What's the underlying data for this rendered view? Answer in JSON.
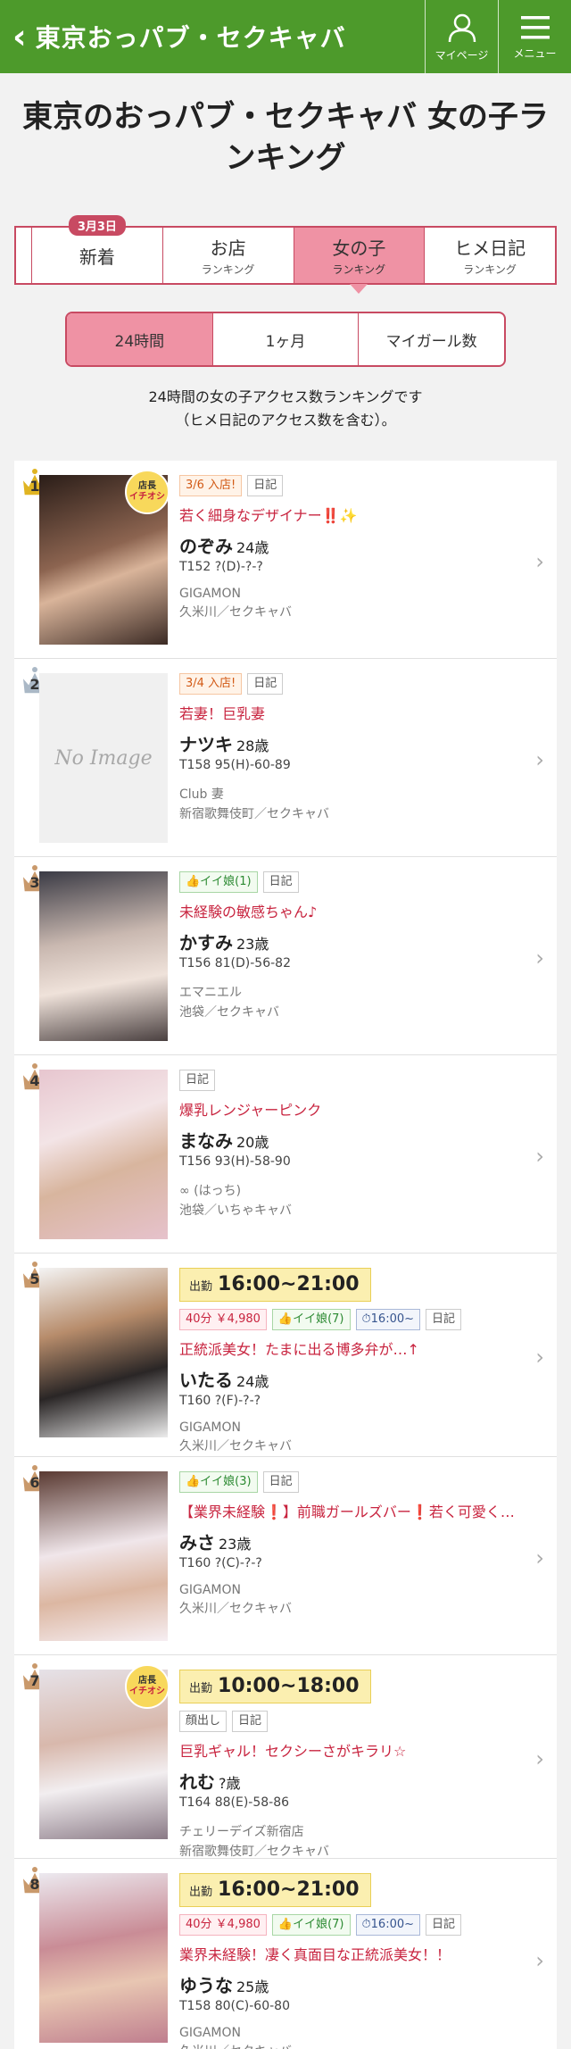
{
  "header": {
    "back_icon": "chevron-left-icon",
    "title": "東京おっパブ・セクキャバ",
    "mypage_label": "マイページ",
    "menu_label": "メニュー",
    "color": "#4d9a2b"
  },
  "page_title": "東京のおっパブ・セクキャバ 女の子ランキング",
  "category_tabs": {
    "new_badge": "3月3日",
    "items": [
      {
        "main": "",
        "sub": ""
      },
      {
        "main": "新着",
        "sub": ""
      },
      {
        "main": "お店",
        "sub": "ランキング"
      },
      {
        "main": "女の子",
        "sub": "ランキング"
      },
      {
        "main": "ヒメ日記",
        "sub": "ランキング"
      }
    ],
    "active_color": "#ef92a4"
  },
  "period_tabs": [
    "24時間",
    "1ヶ月",
    "マイガール数"
  ],
  "description": {
    "line1": "24時間の女の子アクセス数ランキングです",
    "line2": "（ヒメ日記のアクセス数を含む）。"
  },
  "ranking": [
    {
      "rank": "1",
      "crown": "gold",
      "ribbon": true,
      "no_image": false,
      "tags": [
        {
          "t": "3/6 入店!",
          "k": "new"
        },
        {
          "t": "日記",
          "k": ""
        }
      ],
      "work": null,
      "catch": "若く細身なデザイナー‼️✨",
      "name": "のぞみ",
      "age": "24歳",
      "spec": "T152 ?(D)-?-?",
      "shop": "GIGAMON",
      "area": "久米川／セクキャバ"
    },
    {
      "rank": "2",
      "crown": "silver",
      "ribbon": false,
      "no_image": true,
      "no_image_text": "No Image",
      "tags": [
        {
          "t": "3/4 入店!",
          "k": "new"
        },
        {
          "t": "日記",
          "k": ""
        }
      ],
      "work": null,
      "catch": "若妻！巨乳妻",
      "name": "ナツキ",
      "age": "28歳",
      "spec": "T158 95(H)-60-89",
      "shop": "Club 妻",
      "area": "新宿歌舞伎町／セクキャバ"
    },
    {
      "rank": "3",
      "crown": "bronze",
      "ribbon": false,
      "no_image": false,
      "tags": [
        {
          "t": "👍イイ娘(1)",
          "k": "iiko"
        },
        {
          "t": "日記",
          "k": ""
        }
      ],
      "work": null,
      "catch": "未経験の敏感ちゃん♪",
      "name": "かすみ",
      "age": "23歳",
      "spec": "T156 81(D)-56-82",
      "shop": "エマニエル",
      "area": "池袋／セクキャバ"
    },
    {
      "rank": "4",
      "crown": "bronze",
      "ribbon": false,
      "no_image": false,
      "tags": [
        {
          "t": "日記",
          "k": ""
        }
      ],
      "work": null,
      "catch": "爆乳レンジャーピンク",
      "name": "まなみ",
      "age": "20歳",
      "spec": "T156 93(H)-58-90",
      "shop": "∞ (はっち)",
      "area": "池袋／いちゃキャバ"
    },
    {
      "rank": "5",
      "crown": "bronze",
      "ribbon": false,
      "no_image": false,
      "work": {
        "label": "出勤",
        "time": "16:00~21:00"
      },
      "tags": [
        {
          "t": "40分 ￥4,980",
          "k": "price"
        },
        {
          "t": "👍イイ娘(7)",
          "k": "iiko"
        },
        {
          "t": "⏱16:00~",
          "k": "time"
        },
        {
          "t": "日記",
          "k": ""
        }
      ],
      "catch": "正統派美女！たまに出る博多弁が…↑",
      "name": "いたる",
      "age": "24歳",
      "spec": "T160 ?(F)-?-?",
      "shop": "GIGAMON",
      "area": "久米川／セクキャバ"
    },
    {
      "rank": "6",
      "crown": "bronze",
      "ribbon": false,
      "no_image": false,
      "tags": [
        {
          "t": "👍イイ娘(3)",
          "k": "iiko"
        },
        {
          "t": "日記",
          "k": ""
        }
      ],
      "work": null,
      "catch": "【業界未経験❗️】前職ガールズバー❗️若く可愛く…",
      "name": "みさ",
      "age": "23歳",
      "spec": "T160 ?(C)-?-?",
      "shop": "GIGAMON",
      "area": "久米川／セクキャバ"
    },
    {
      "rank": "7",
      "crown": "bronze",
      "ribbon": true,
      "no_image": false,
      "work": {
        "label": "出勤",
        "time": "10:00~18:00"
      },
      "tags": [
        {
          "t": "顔出し",
          "k": ""
        },
        {
          "t": "日記",
          "k": ""
        }
      ],
      "catch": "巨乳ギャル！セクシーさがキラリ☆",
      "name": "れむ",
      "age": "?歳",
      "spec": "T164 88(E)-58-86",
      "shop": "チェリーデイズ新宿店",
      "area": "新宿歌舞伎町／セクキャバ"
    },
    {
      "rank": "8",
      "crown": "bronze",
      "ribbon": false,
      "no_image": false,
      "work": {
        "label": "出勤",
        "time": "16:00~21:00"
      },
      "tags": [
        {
          "t": "40分 ￥4,980",
          "k": "price"
        },
        {
          "t": "👍イイ娘(7)",
          "k": "iiko"
        },
        {
          "t": "⏱16:00~",
          "k": "time"
        },
        {
          "t": "日記",
          "k": ""
        }
      ],
      "catch": "業界未経験！凄く真面目な正統派美女！！",
      "name": "ゆうな",
      "age": "25歳",
      "spec": "T158 80(C)-60-80",
      "shop": "GIGAMON",
      "area": "久米川／セクキャバ"
    }
  ],
  "ribbon_text": {
    "top": "店長",
    "bottom": "イチオシ"
  },
  "crown_colors": {
    "gold": "#e0b422",
    "silver": "#aab8c6",
    "bronze": "#c9996b"
  }
}
